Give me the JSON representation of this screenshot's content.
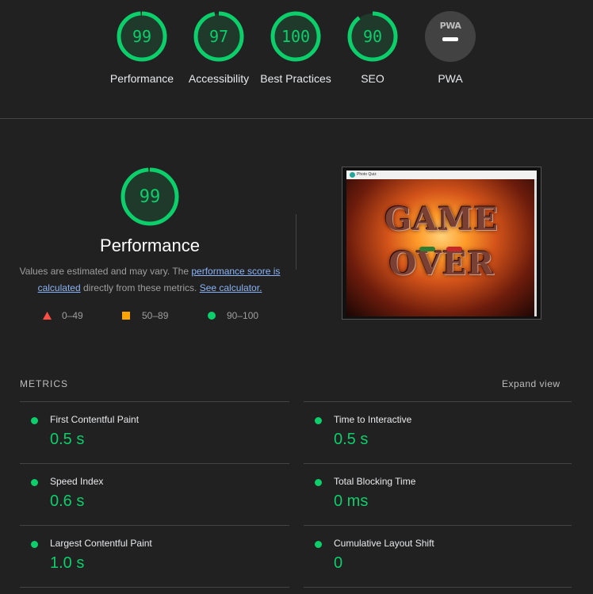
{
  "categories": [
    {
      "label": "Performance",
      "score": "99",
      "fraction": 0.99
    },
    {
      "label": "Accessibility",
      "score": "97",
      "fraction": 0.97
    },
    {
      "label": "Best Practices",
      "score": "100",
      "fraction": 1.0
    },
    {
      "label": "SEO",
      "score": "90",
      "fraction": 0.9
    },
    {
      "label": "PWA",
      "badge": "PWA"
    }
  ],
  "performance": {
    "score": "99",
    "fraction": 0.99,
    "title": "Performance",
    "desc_pre": "Values are estimated and may vary. The ",
    "desc_link1": "performance score is calculated",
    "desc_mid": " directly from these metrics. ",
    "desc_link2": "See calculator."
  },
  "legend": [
    {
      "label": "0–49",
      "color": "#ff4e42",
      "shape": "triangle"
    },
    {
      "label": "50–89",
      "color": "#ffa400",
      "shape": "square"
    },
    {
      "label": "90–100",
      "color": "#0cce6b",
      "shape": "circle"
    }
  ],
  "screenshot": {
    "browser_title": "Photo Quiz",
    "line1": "GAME",
    "line2": "OVER"
  },
  "metrics": {
    "heading": "METRICS",
    "expand_label": "Expand view",
    "items": [
      {
        "name": "First Contentful Paint",
        "value": "0.5 s"
      },
      {
        "name": "Time to Interactive",
        "value": "0.5 s"
      },
      {
        "name": "Speed Index",
        "value": "0.6 s"
      },
      {
        "name": "Total Blocking Time",
        "value": "0 ms"
      },
      {
        "name": "Largest Contentful Paint",
        "value": "1.0 s"
      },
      {
        "name": "Cumulative Layout Shift",
        "value": "0"
      }
    ]
  },
  "colors": {
    "pass": "#0cce6b",
    "background": "#212121",
    "link": "#8ab4f8"
  }
}
